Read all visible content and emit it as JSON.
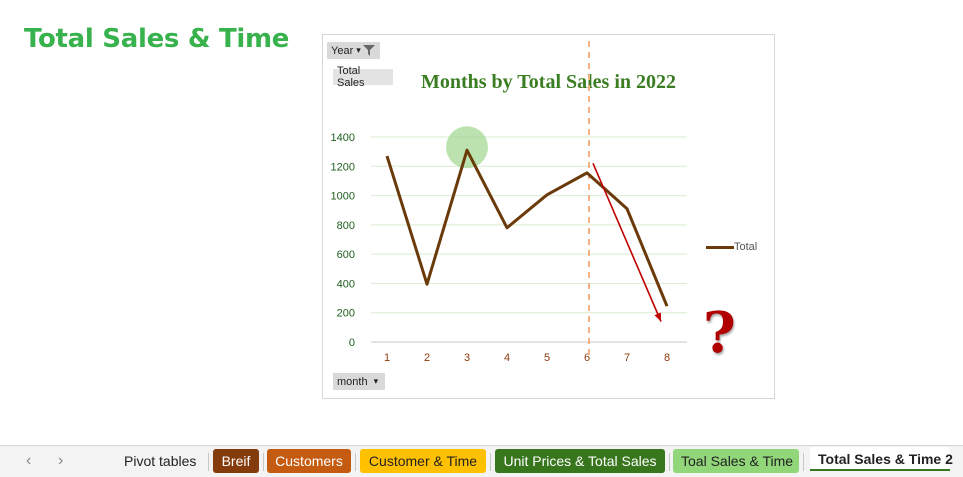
{
  "page": {
    "title": "Total Sales & Time",
    "title_color": "#37b24d"
  },
  "pivot": {
    "filter_label": "Year",
    "value_label": "Total Sales",
    "axis_label": "month"
  },
  "colors": {
    "line": "#6b3a0a",
    "tick_y": "#1f5e1f",
    "tick_x": "#8b3a0a",
    "highlight": "#8fd07a",
    "arrow": "#c00000",
    "divider": "#f4b183",
    "gridline": "#d9ecd2",
    "title": "#3a7d22"
  },
  "chart_data": {
    "type": "line",
    "title": "Months by Total Sales in 2022",
    "xlabel": "",
    "ylabel": "",
    "categories": [
      "1",
      "2",
      "3",
      "4",
      "5",
      "6",
      "7",
      "8"
    ],
    "series": [
      {
        "name": "Total",
        "values": [
          1270,
          395,
          1310,
          780,
          1005,
          1155,
          910,
          245
        ]
      }
    ],
    "ylim": [
      0,
      1400
    ],
    "yticks": [
      0,
      200,
      400,
      600,
      800,
      1000,
      1200,
      1400
    ],
    "grid": true,
    "legend": "right",
    "annotations": [
      {
        "kind": "highlight-circle",
        "at_category": "3",
        "at_value": 1330
      },
      {
        "kind": "vertical-dashed-line",
        "at_category": "6"
      },
      {
        "kind": "downward-arrow",
        "from": [
          "6",
          1220
        ],
        "to": [
          "8",
          140
        ]
      },
      {
        "kind": "question-mark",
        "text": "?"
      }
    ]
  },
  "tabs": {
    "prev_icon": "‹",
    "next_icon": "›",
    "items": [
      {
        "label": "Pivot tables",
        "bg": "",
        "color": "#222222",
        "active": false
      },
      {
        "label": "Breif",
        "bg": "#843c0c",
        "color": "#ffffff",
        "active": false
      },
      {
        "label": "Customers",
        "bg": "#c55a11",
        "color": "#ffffff",
        "active": false
      },
      {
        "label": "Customer & Time",
        "bg": "#ffc000",
        "color": "#222222",
        "active": false
      },
      {
        "label": "Unit Prices & Total Sales",
        "bg": "#38761d",
        "color": "#ffffff",
        "active": false
      },
      {
        "label": "Toal Sales & Time",
        "bg": "#92d67a",
        "color": "#222222",
        "active": false
      },
      {
        "label": "Total Sales & Time 2",
        "bg": "#ffffff",
        "color": "#222222",
        "active": true,
        "underline": "#38761d"
      }
    ]
  }
}
